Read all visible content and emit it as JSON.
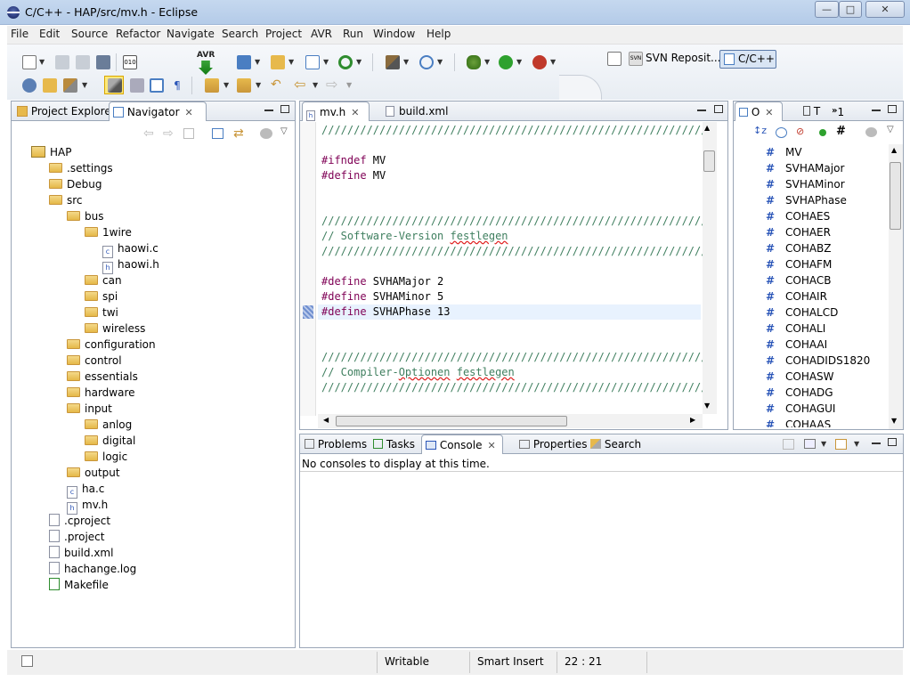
{
  "window": {
    "title": "C/C++ - HAP/src/mv.h - Eclipse"
  },
  "menu": [
    "File",
    "Edit",
    "Source",
    "Refactor",
    "Navigate",
    "Search",
    "Project",
    "AVR",
    "Run",
    "Window",
    "Help"
  ],
  "perspectives": {
    "svn": "SVN Reposit...",
    "cpp": "C/C++"
  },
  "toolbar": {
    "avr_label": "AVR"
  },
  "left_view": {
    "tabs": [
      "Project Explorer",
      "Navigator"
    ],
    "tree": [
      {
        "label": "HAP",
        "type": "project",
        "level": 0
      },
      {
        "label": ".settings",
        "type": "folder",
        "level": 1
      },
      {
        "label": "Debug",
        "type": "folder",
        "level": 1
      },
      {
        "label": "src",
        "type": "folder",
        "level": 1
      },
      {
        "label": "bus",
        "type": "folder",
        "level": 2
      },
      {
        "label": "1wire",
        "type": "folder",
        "level": 3
      },
      {
        "label": "haowi.c",
        "type": "cfile",
        "level": 4
      },
      {
        "label": "haowi.h",
        "type": "hfile",
        "level": 4
      },
      {
        "label": "can",
        "type": "folder",
        "level": 3
      },
      {
        "label": "spi",
        "type": "folder",
        "level": 3
      },
      {
        "label": "twi",
        "type": "folder",
        "level": 3
      },
      {
        "label": "wireless",
        "type": "folder",
        "level": 3
      },
      {
        "label": "configuration",
        "type": "folder",
        "level": 2
      },
      {
        "label": "control",
        "type": "folder",
        "level": 2
      },
      {
        "label": "essentials",
        "type": "folder",
        "level": 2
      },
      {
        "label": "hardware",
        "type": "folder",
        "level": 2
      },
      {
        "label": "input",
        "type": "folder",
        "level": 2
      },
      {
        "label": "anlog",
        "type": "folder",
        "level": 3
      },
      {
        "label": "digital",
        "type": "folder",
        "level": 3
      },
      {
        "label": "logic",
        "type": "folder",
        "level": 3
      },
      {
        "label": "output",
        "type": "folder",
        "level": 2
      },
      {
        "label": "ha.c",
        "type": "cfile",
        "level": 2
      },
      {
        "label": "mv.h",
        "type": "hfile",
        "level": 2
      },
      {
        "label": ".cproject",
        "type": "file",
        "level": 1
      },
      {
        "label": ".project",
        "type": "file",
        "level": 1
      },
      {
        "label": "build.xml",
        "type": "file",
        "level": 1
      },
      {
        "label": "hachange.log",
        "type": "file",
        "level": 1
      },
      {
        "label": "Makefile",
        "type": "make",
        "level": 1
      }
    ]
  },
  "editor": {
    "tabs": [
      "mv.h",
      "build.xml"
    ],
    "lines": [
      {
        "kind": "cm",
        "text": "////////////////////////////////////////////////////////////"
      },
      {
        "kind": "blank",
        "text": ""
      },
      {
        "kind": "pp",
        "kw": "#ifndef",
        "rest": " MV"
      },
      {
        "kind": "pp",
        "kw": "#define",
        "rest": " MV"
      },
      {
        "kind": "blank",
        "text": ""
      },
      {
        "kind": "blank",
        "text": ""
      },
      {
        "kind": "cm",
        "text": "////////////////////////////////////////////////////////////"
      },
      {
        "kind": "cm",
        "text": "// Software-Version festlegen"
      },
      {
        "kind": "cm",
        "text": "////////////////////////////////////////////////////////////"
      },
      {
        "kind": "blank",
        "text": ""
      },
      {
        "kind": "pp",
        "kw": "#define",
        "rest": " SVHAMajor 2"
      },
      {
        "kind": "pp",
        "kw": "#define",
        "rest": " SVHAMinor 5"
      },
      {
        "kind": "pp",
        "kw": "#define",
        "rest": " SVHAPhase 13"
      },
      {
        "kind": "blank",
        "text": ""
      },
      {
        "kind": "blank",
        "text": ""
      },
      {
        "kind": "cm",
        "text": "////////////////////////////////////////////////////////////"
      },
      {
        "kind": "cm",
        "text": "// Compiler-Optionen festlegen"
      },
      {
        "kind": "cm",
        "text": "////////////////////////////////////////////////////////////"
      }
    ]
  },
  "outline": {
    "tabs": [
      "O",
      "T",
      "1"
    ],
    "items": [
      "MV",
      "SVHAMajor",
      "SVHAMinor",
      "SVHAPhase",
      "COHAES",
      "COHAER",
      "COHABZ",
      "COHAFM",
      "COHACB",
      "COHAIR",
      "COHALCD",
      "COHALI",
      "COHAAI",
      "COHADIDS1820",
      "COHASW",
      "COHADG",
      "COHAGUI",
      "COHAAS"
    ]
  },
  "bottom": {
    "tabs": [
      "Problems",
      "Tasks",
      "Console",
      "Properties",
      "Search"
    ],
    "message": "No consoles to display at this time."
  },
  "status": {
    "mode": "Writable",
    "insert": "Smart Insert",
    "position": "22 : 21"
  },
  "colors": {
    "keyword": "#7f0055",
    "comment": "#3f7f5f",
    "accent": "#2b56b8"
  }
}
